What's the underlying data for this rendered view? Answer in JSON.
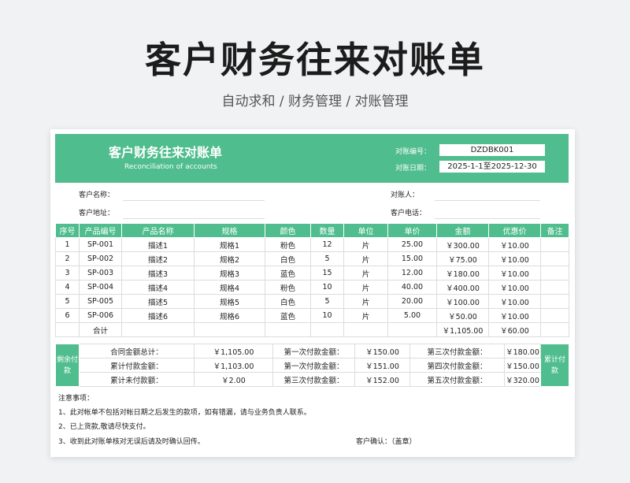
{
  "title": "客户财务往来对账单",
  "subtitle": "自动求和  /  财务管理  /  对账管理",
  "banner": {
    "title": "客户财务往来对账单",
    "subtitle_en": "Reconciliation of accounts",
    "number_label": "对账编号：",
    "number_value": "DZDBK001",
    "date_label": "对账日期：",
    "date_value": "2025-1-1至2025-12-30"
  },
  "info": {
    "customer_name_label": "客户名称：",
    "customer_address_label": "客户地址：",
    "reconciler_label": "对账人：",
    "customer_phone_label": "客户电话："
  },
  "table": {
    "headers": [
      "序号",
      "产品编号",
      "产品名称",
      "规格",
      "颜色",
      "数量",
      "单位",
      "单价",
      "金额",
      "优惠价",
      "备注"
    ],
    "rows": [
      [
        "1",
        "SP-001",
        "描述1",
        "规格1",
        "粉色",
        "12",
        "片",
        "25.00",
        "￥300.00",
        "￥10.00",
        ""
      ],
      [
        "2",
        "SP-002",
        "描述2",
        "规格2",
        "白色",
        "5",
        "片",
        "15.00",
        "￥75.00",
        "￥10.00",
        ""
      ],
      [
        "3",
        "SP-003",
        "描述3",
        "规格3",
        "蓝色",
        "15",
        "片",
        "12.00",
        "￥180.00",
        "￥10.00",
        ""
      ],
      [
        "4",
        "SP-004",
        "描述4",
        "规格4",
        "粉色",
        "10",
        "片",
        "40.00",
        "￥400.00",
        "￥10.00",
        ""
      ],
      [
        "5",
        "SP-005",
        "描述5",
        "规格5",
        "白色",
        "5",
        "片",
        "20.00",
        "￥100.00",
        "￥10.00",
        ""
      ],
      [
        "6",
        "SP-006",
        "描述6",
        "规格6",
        "蓝色",
        "10",
        "片",
        "5.00",
        "￥50.00",
        "￥10.00",
        ""
      ]
    ],
    "total_label": "合计",
    "total_amount": "￥1,105.00",
    "total_discount": "￥60.00"
  },
  "payment": {
    "left_label": "剩余付款",
    "right_label": "累计付款",
    "rows": [
      [
        "合同金额总计：",
        "￥1,105.00",
        "第一次付款金额：",
        "￥150.00",
        "第三次付款金额：",
        "￥180.00"
      ],
      [
        "累计付款金额：",
        "￥1,103.00",
        "第一次付款金额：",
        "￥151.00",
        "第四次付款金额：",
        "￥150.00"
      ],
      [
        "累计未付款额：",
        "￥2.00",
        "第三次付款金额：",
        "￥152.00",
        "第五次付款金额：",
        "￥320.00"
      ]
    ]
  },
  "notes": {
    "heading": "注意事项：",
    "items": [
      "1、此对帐单不包括对帐日期之后发生的款项，如有错漏，请与业务负责人联系。",
      "2、已上货款,敬请尽快支付。",
      "3、收到此对账单核对无误后请及时确认回传。"
    ],
    "customer_confirm": "客户确认：（盖章）"
  },
  "colors": {
    "accent": "#4fbd8d"
  }
}
